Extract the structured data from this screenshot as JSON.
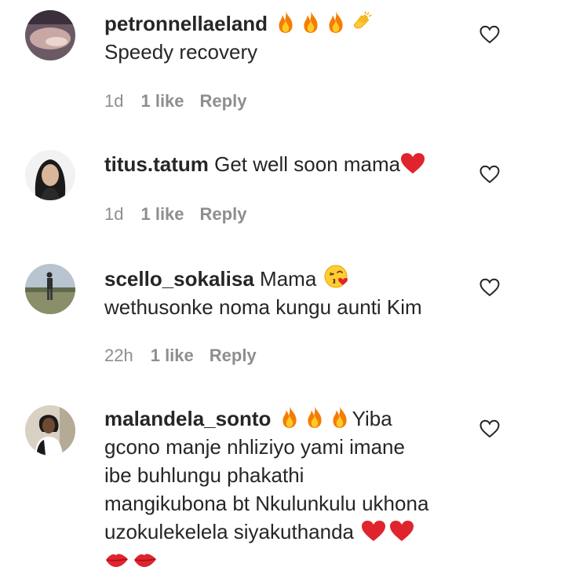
{
  "colors": {
    "text": "#262626",
    "meta": "#8e8e8e",
    "heart_red": "#e0242e",
    "fire": "#f57c00"
  },
  "comments": [
    {
      "username": "petronnellaeland",
      "emoji_after_username": [
        "fire",
        "fire",
        "fire",
        "clapping-hands"
      ],
      "text_line1": "Speedy recovery",
      "time": "1d",
      "likes": "1 like",
      "reply": "Reply"
    },
    {
      "username": "titus.tatum",
      "text_line1": "Get well soon mama",
      "emoji_after_text": [
        "red-heart"
      ],
      "time": "1d",
      "likes": "1 like",
      "reply": "Reply"
    },
    {
      "username": "scello_sokalisa",
      "text_line1": "Mama",
      "emoji_after_text": [
        "kissing-face"
      ],
      "text_line2": "wethusonke noma kungu aunti Kim",
      "time": "22h",
      "likes": "1 like",
      "reply": "Reply"
    },
    {
      "username": "malandela_sonto",
      "emoji_after_username": [
        "fire",
        "fire",
        "fire"
      ],
      "text_line1": "Yiba",
      "text_line2": "gcono manje nhliziyo yami imane",
      "text_line3": "ibe buhlungu phakathi",
      "text_line4": "mangikubona bt Nkulunkulu ukhona",
      "text_line5": "uzokulekelela siyakuthanda",
      "emoji_line5": [
        "red-heart",
        "red-heart"
      ],
      "emoji_line6": [
        "kiss-mark",
        "kiss-mark"
      ]
    }
  ]
}
